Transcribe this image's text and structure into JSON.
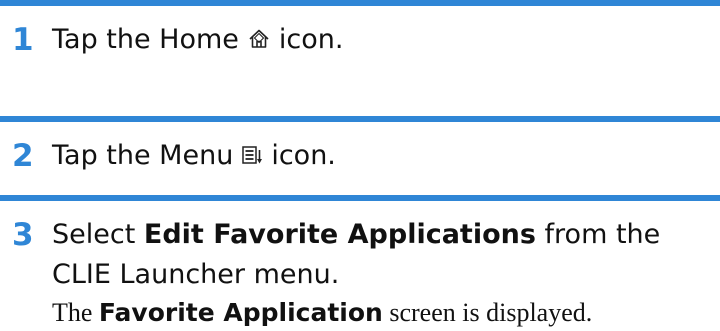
{
  "steps": [
    {
      "number": "1",
      "before_icon": "Tap the Home",
      "icon": "home-icon",
      "after_icon": "icon."
    },
    {
      "number": "2",
      "before_icon": "Tap the Menu",
      "icon": "menu-icon",
      "after_icon": "icon."
    },
    {
      "number": "3",
      "prefix": "Select",
      "bold": "Edit Favorite Applications",
      "suffix": "from the CLIE Launcher menu.",
      "result": {
        "prefix": "The",
        "bold": "Favorite Application",
        "suffix": "screen is displayed."
      }
    }
  ],
  "colors": {
    "accent": "#2f86d6",
    "text": "#111111"
  }
}
